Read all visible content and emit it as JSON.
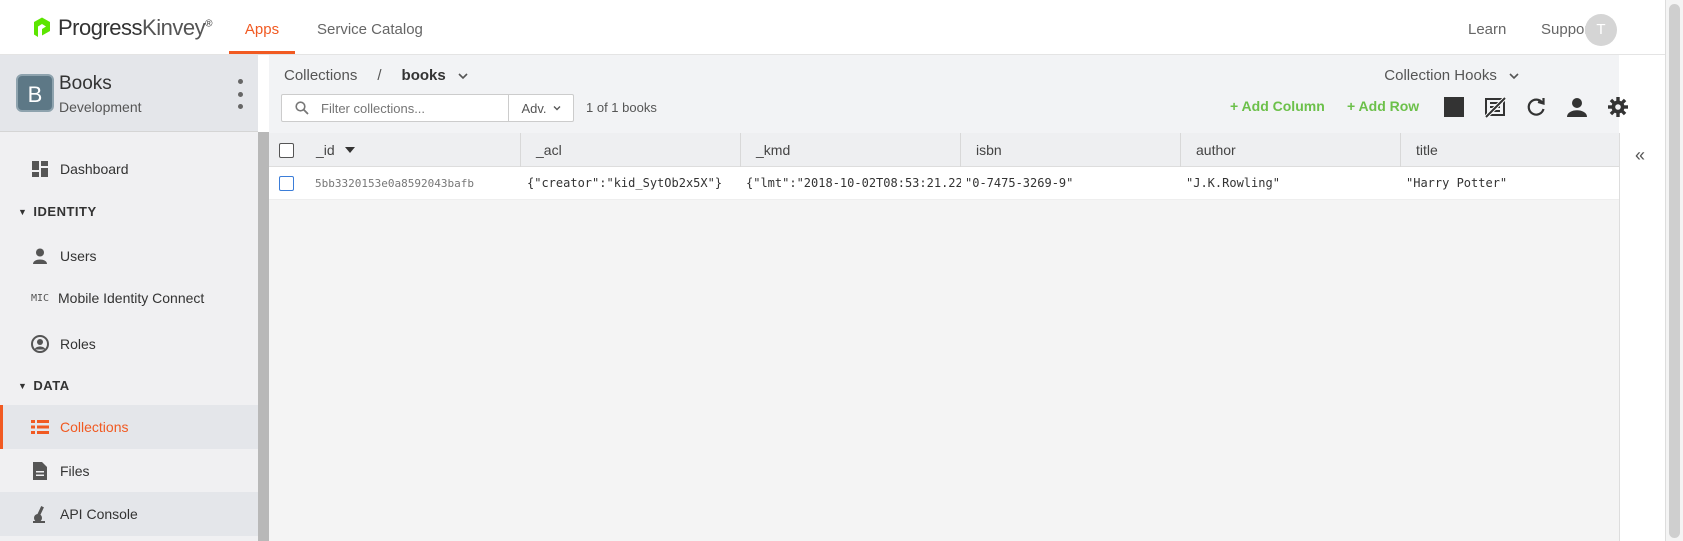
{
  "brand": {
    "name": "Progress Kinvey",
    "logo_word1": "Progress",
    "logo_word2": "Kinvey",
    "accent": "#f15a22",
    "green": "#6cc04a"
  },
  "topnav": {
    "tabs": [
      {
        "label": "Apps",
        "active": true
      },
      {
        "label": "Service Catalog",
        "active": false
      }
    ],
    "learn": "Learn",
    "support": "Support",
    "avatar_initial": "T"
  },
  "app": {
    "badge": "B",
    "name": "Books",
    "environment": "Development"
  },
  "sidebar": {
    "dashboard": "Dashboard",
    "identity_section": "IDENTITY",
    "users": "Users",
    "mic_icon_text": "MIC",
    "mic": "Mobile Identity Connect",
    "roles": "Roles",
    "data_section": "DATA",
    "collections": "Collections",
    "files": "Files",
    "api_console": "API Console"
  },
  "header": {
    "breadcrumb_root": "Collections",
    "breadcrumb_sep": "/",
    "breadcrumb_current": "books",
    "collection_hooks": "Collection Hooks",
    "filter_placeholder": "Filter collections...",
    "adv_label": "Adv.",
    "count": "1 of 1 books",
    "add_column": "+ Add Column",
    "add_row": "+ Add Row"
  },
  "table": {
    "columns": [
      "_id",
      "_acl",
      "_kmd",
      "isbn",
      "author",
      "title"
    ],
    "rows": [
      {
        "_id": "5bb3320153e0a8592043bafb",
        "_acl": "{\"creator\":\"kid_SytOb2x5X\"}",
        "_kmd": "{\"lmt\":\"2018-10-02T08:53:21.22",
        "isbn": "\"0-7475-3269-9\"",
        "author": "\"J.K.Rowling\"",
        "title": "\"Harry Potter\""
      }
    ]
  }
}
